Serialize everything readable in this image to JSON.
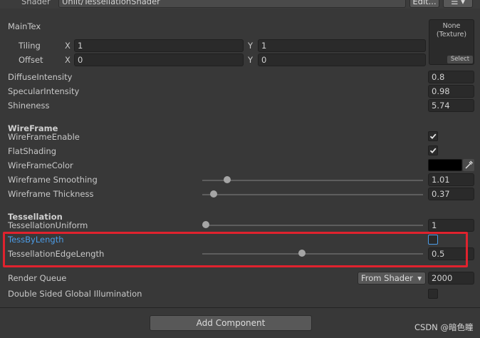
{
  "header": {
    "shader_label": "Shader",
    "shader_value": "Unlit/TessellationShader",
    "edit_label": "Edit..."
  },
  "maintex": {
    "label": "MainTex",
    "tiling_label": "Tiling",
    "offset_label": "Offset",
    "x_label": "X",
    "y_label": "Y",
    "tiling_x": "1",
    "tiling_y": "1",
    "offset_x": "0",
    "offset_y": "0",
    "texture_none": "None",
    "texture_type": "(Texture)",
    "select_label": "Select"
  },
  "props": {
    "diffuse_label": "DiffuseIntensity",
    "diffuse_value": "0.8",
    "specular_label": "SpecularIntensity",
    "specular_value": "0.98",
    "shininess_label": "Shineness",
    "shininess_value": "5.74"
  },
  "wireframe": {
    "header": "WireFrame",
    "enable_label": "WireFrameEnable",
    "enable_checked": true,
    "flat_label": "FlatShading",
    "flat_checked": true,
    "color_label": "WireFrameColor",
    "color_value": "#000000",
    "smoothing_label": "Wireframe Smoothing",
    "smoothing_value": "1.01",
    "thickness_label": "Wireframe Thickness",
    "thickness_value": "0.37"
  },
  "tessellation": {
    "header": "Tessellation",
    "uniform_label": "TessellationUniform",
    "uniform_value": "1",
    "bylength_label": "TessByLength",
    "bylength_checked": false,
    "edge_label": "TessellationEdgeLength",
    "edge_value": "0.5"
  },
  "render_queue": {
    "label": "Render Queue",
    "dropdown": "From Shader",
    "value": "2000"
  },
  "double_sided": {
    "label": "Double Sided Global Illumination",
    "checked": false
  },
  "add_component_label": "Add Component",
  "watermark": "CSDN @暗色瞳",
  "colors": {
    "accent_link": "#4c9de8",
    "highlight": "#e0222e"
  }
}
